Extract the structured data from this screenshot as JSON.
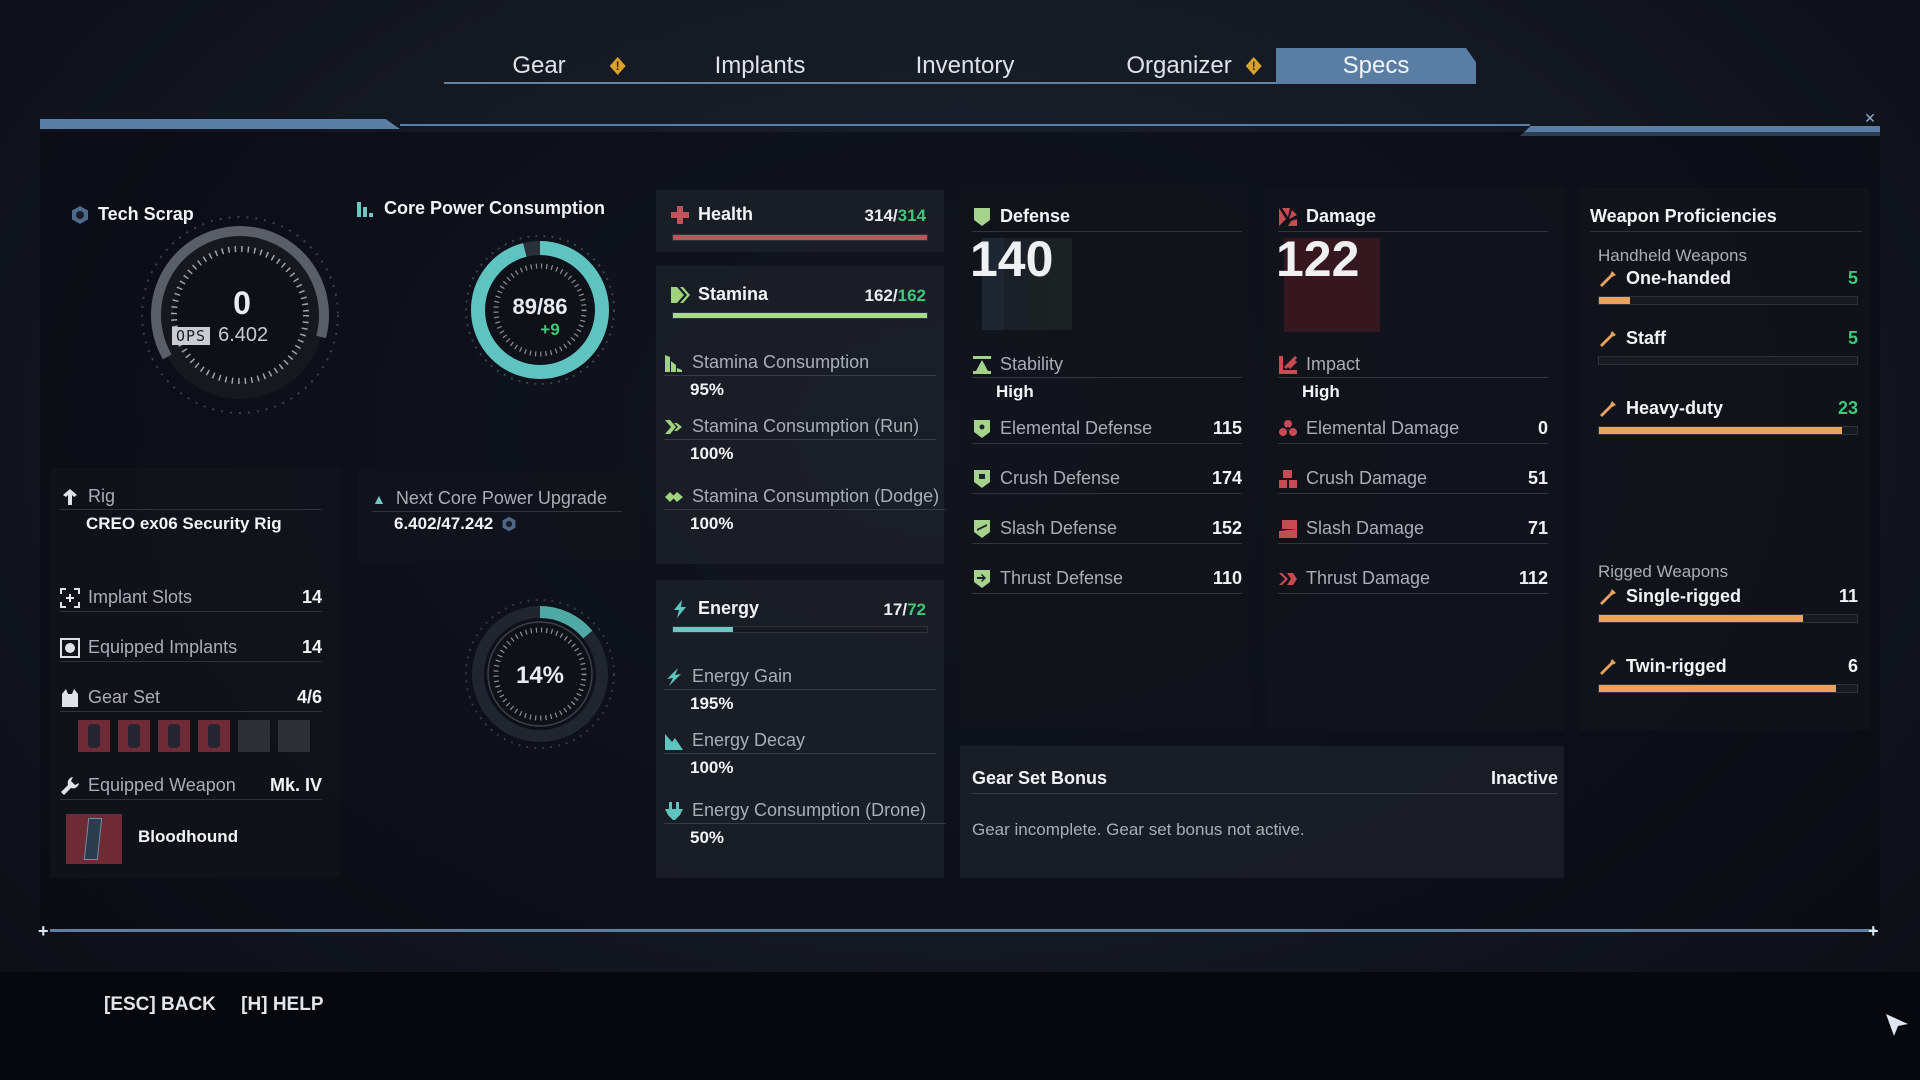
{
  "tabs": [
    {
      "label": "Gear",
      "alert": true,
      "active": false
    },
    {
      "label": "Implants",
      "alert": false,
      "active": false
    },
    {
      "label": "Inventory",
      "alert": false,
      "active": false
    },
    {
      "label": "Organizer",
      "alert": true,
      "active": false
    },
    {
      "label": "Specs",
      "alert": false,
      "active": true
    }
  ],
  "colors": {
    "accent_blue": "#5a7ea3",
    "health": "#c0525a",
    "stamina": "#9fd37e",
    "energy": "#5fc4c0",
    "defense_icon": "#a5d38b",
    "damage_icon": "#c84a52",
    "proficiency": "#e8a45e",
    "value_green": "#3ec97a",
    "alert": "#d8a22b"
  },
  "tech_scrap": {
    "title": "Tech Scrap",
    "value": "0",
    "ops_label": "OPS",
    "ops_value": "6.402"
  },
  "core_power": {
    "title": "Core Power Consumption",
    "value": "89/86",
    "bonus": "+9",
    "fill_fraction": 0.96,
    "next_upgrade_label": "Next Core Power Upgrade",
    "next_upgrade_value": "6.402/47.242",
    "upgrade_percent_label": "14%",
    "upgrade_fraction": 0.14
  },
  "rig": {
    "label": "Rig",
    "name": "CREO ex06 Security Rig"
  },
  "left_stats": [
    {
      "label": "Implant Slots",
      "value": "14"
    },
    {
      "label": "Equipped Implants",
      "value": "14"
    },
    {
      "label": "Gear Set",
      "value": "4/6"
    }
  ],
  "gear_set_slots": [
    true,
    true,
    true,
    true,
    false,
    false
  ],
  "equipped_weapon": {
    "label": "Equipped Weapon",
    "tier": "Mk. IV",
    "name": "Bloodhound"
  },
  "health": {
    "label": "Health",
    "current": "314",
    "max": "314",
    "fraction": 1.0
  },
  "stamina": {
    "label": "Stamina",
    "current": "162",
    "max": "162",
    "fraction": 1.0,
    "stats": [
      {
        "label": "Stamina Consumption",
        "value": "95%"
      },
      {
        "label": "Stamina Consumption (Run)",
        "value": "100%"
      },
      {
        "label": "Stamina Consumption (Dodge)",
        "value": "100%"
      }
    ]
  },
  "energy": {
    "label": "Energy",
    "current": "17",
    "max": "72",
    "fraction": 0.236,
    "stats": [
      {
        "label": "Energy Gain",
        "value": "195%"
      },
      {
        "label": "Energy Decay",
        "value": "100%"
      },
      {
        "label": "Energy Consumption (Drone)",
        "value": "50%"
      }
    ]
  },
  "defense": {
    "title": "Defense",
    "total": "140",
    "stability_label": "Stability",
    "stability_value": "High",
    "rows": [
      {
        "label": "Elemental Defense",
        "value": "115"
      },
      {
        "label": "Crush Defense",
        "value": "174"
      },
      {
        "label": "Slash Defense",
        "value": "152"
      },
      {
        "label": "Thrust Defense",
        "value": "110"
      }
    ]
  },
  "damage": {
    "title": "Damage",
    "total": "122",
    "impact_label": "Impact",
    "impact_value": "High",
    "rows": [
      {
        "label": "Elemental Damage",
        "value": "0"
      },
      {
        "label": "Crush Damage",
        "value": "51"
      },
      {
        "label": "Slash Damage",
        "value": "71"
      },
      {
        "label": "Thrust Damage",
        "value": "112"
      }
    ]
  },
  "gear_set_bonus": {
    "title": "Gear Set Bonus",
    "status": "Inactive",
    "description": "Gear incomplete. Gear set bonus not active."
  },
  "proficiencies": {
    "title": "Weapon Proficiencies",
    "groups": [
      {
        "title": "Handheld Weapons",
        "items": [
          {
            "label": "One-handed",
            "value": "5",
            "progress": 0.12,
            "value_green": true
          },
          {
            "label": "Staff",
            "value": "5",
            "progress": 0.0,
            "value_green": true
          },
          {
            "label": "Heavy-duty",
            "value": "23",
            "progress": 0.94,
            "value_green": true
          }
        ]
      },
      {
        "title": "Rigged Weapons",
        "items": [
          {
            "label": "Single-rigged",
            "value": "11",
            "progress": 0.79,
            "value_green": false
          },
          {
            "label": "Twin-rigged",
            "value": "6",
            "progress": 0.92,
            "value_green": false
          }
        ]
      }
    ]
  },
  "footer": {
    "back": "[ESC] BACK",
    "help": "[H] HELP"
  }
}
